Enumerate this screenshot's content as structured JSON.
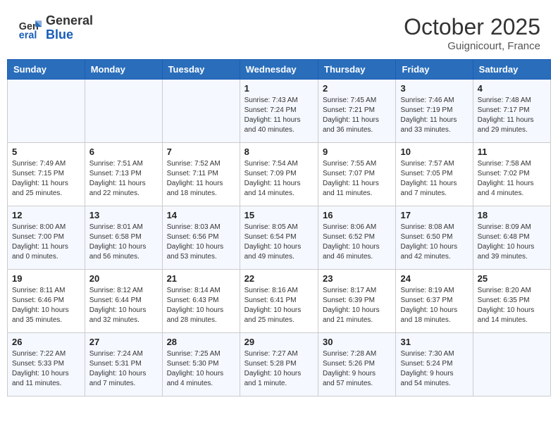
{
  "header": {
    "logo_line1": "General",
    "logo_line2": "Blue",
    "month_year": "October 2025",
    "location": "Guignicourt, France"
  },
  "weekdays": [
    "Sunday",
    "Monday",
    "Tuesday",
    "Wednesday",
    "Thursday",
    "Friday",
    "Saturday"
  ],
  "weeks": [
    [
      {
        "day": "",
        "info": ""
      },
      {
        "day": "",
        "info": ""
      },
      {
        "day": "",
        "info": ""
      },
      {
        "day": "1",
        "info": "Sunrise: 7:43 AM\nSunset: 7:24 PM\nDaylight: 11 hours\nand 40 minutes."
      },
      {
        "day": "2",
        "info": "Sunrise: 7:45 AM\nSunset: 7:21 PM\nDaylight: 11 hours\nand 36 minutes."
      },
      {
        "day": "3",
        "info": "Sunrise: 7:46 AM\nSunset: 7:19 PM\nDaylight: 11 hours\nand 33 minutes."
      },
      {
        "day": "4",
        "info": "Sunrise: 7:48 AM\nSunset: 7:17 PM\nDaylight: 11 hours\nand 29 minutes."
      }
    ],
    [
      {
        "day": "5",
        "info": "Sunrise: 7:49 AM\nSunset: 7:15 PM\nDaylight: 11 hours\nand 25 minutes."
      },
      {
        "day": "6",
        "info": "Sunrise: 7:51 AM\nSunset: 7:13 PM\nDaylight: 11 hours\nand 22 minutes."
      },
      {
        "day": "7",
        "info": "Sunrise: 7:52 AM\nSunset: 7:11 PM\nDaylight: 11 hours\nand 18 minutes."
      },
      {
        "day": "8",
        "info": "Sunrise: 7:54 AM\nSunset: 7:09 PM\nDaylight: 11 hours\nand 14 minutes."
      },
      {
        "day": "9",
        "info": "Sunrise: 7:55 AM\nSunset: 7:07 PM\nDaylight: 11 hours\nand 11 minutes."
      },
      {
        "day": "10",
        "info": "Sunrise: 7:57 AM\nSunset: 7:05 PM\nDaylight: 11 hours\nand 7 minutes."
      },
      {
        "day": "11",
        "info": "Sunrise: 7:58 AM\nSunset: 7:02 PM\nDaylight: 11 hours\nand 4 minutes."
      }
    ],
    [
      {
        "day": "12",
        "info": "Sunrise: 8:00 AM\nSunset: 7:00 PM\nDaylight: 11 hours\nand 0 minutes."
      },
      {
        "day": "13",
        "info": "Sunrise: 8:01 AM\nSunset: 6:58 PM\nDaylight: 10 hours\nand 56 minutes."
      },
      {
        "day": "14",
        "info": "Sunrise: 8:03 AM\nSunset: 6:56 PM\nDaylight: 10 hours\nand 53 minutes."
      },
      {
        "day": "15",
        "info": "Sunrise: 8:05 AM\nSunset: 6:54 PM\nDaylight: 10 hours\nand 49 minutes."
      },
      {
        "day": "16",
        "info": "Sunrise: 8:06 AM\nSunset: 6:52 PM\nDaylight: 10 hours\nand 46 minutes."
      },
      {
        "day": "17",
        "info": "Sunrise: 8:08 AM\nSunset: 6:50 PM\nDaylight: 10 hours\nand 42 minutes."
      },
      {
        "day": "18",
        "info": "Sunrise: 8:09 AM\nSunset: 6:48 PM\nDaylight: 10 hours\nand 39 minutes."
      }
    ],
    [
      {
        "day": "19",
        "info": "Sunrise: 8:11 AM\nSunset: 6:46 PM\nDaylight: 10 hours\nand 35 minutes."
      },
      {
        "day": "20",
        "info": "Sunrise: 8:12 AM\nSunset: 6:44 PM\nDaylight: 10 hours\nand 32 minutes."
      },
      {
        "day": "21",
        "info": "Sunrise: 8:14 AM\nSunset: 6:43 PM\nDaylight: 10 hours\nand 28 minutes."
      },
      {
        "day": "22",
        "info": "Sunrise: 8:16 AM\nSunset: 6:41 PM\nDaylight: 10 hours\nand 25 minutes."
      },
      {
        "day": "23",
        "info": "Sunrise: 8:17 AM\nSunset: 6:39 PM\nDaylight: 10 hours\nand 21 minutes."
      },
      {
        "day": "24",
        "info": "Sunrise: 8:19 AM\nSunset: 6:37 PM\nDaylight: 10 hours\nand 18 minutes."
      },
      {
        "day": "25",
        "info": "Sunrise: 8:20 AM\nSunset: 6:35 PM\nDaylight: 10 hours\nand 14 minutes."
      }
    ],
    [
      {
        "day": "26",
        "info": "Sunrise: 7:22 AM\nSunset: 5:33 PM\nDaylight: 10 hours\nand 11 minutes."
      },
      {
        "day": "27",
        "info": "Sunrise: 7:24 AM\nSunset: 5:31 PM\nDaylight: 10 hours\nand 7 minutes."
      },
      {
        "day": "28",
        "info": "Sunrise: 7:25 AM\nSunset: 5:30 PM\nDaylight: 10 hours\nand 4 minutes."
      },
      {
        "day": "29",
        "info": "Sunrise: 7:27 AM\nSunset: 5:28 PM\nDaylight: 10 hours\nand 1 minute."
      },
      {
        "day": "30",
        "info": "Sunrise: 7:28 AM\nSunset: 5:26 PM\nDaylight: 9 hours\nand 57 minutes."
      },
      {
        "day": "31",
        "info": "Sunrise: 7:30 AM\nSunset: 5:24 PM\nDaylight: 9 hours\nand 54 minutes."
      },
      {
        "day": "",
        "info": ""
      }
    ]
  ]
}
